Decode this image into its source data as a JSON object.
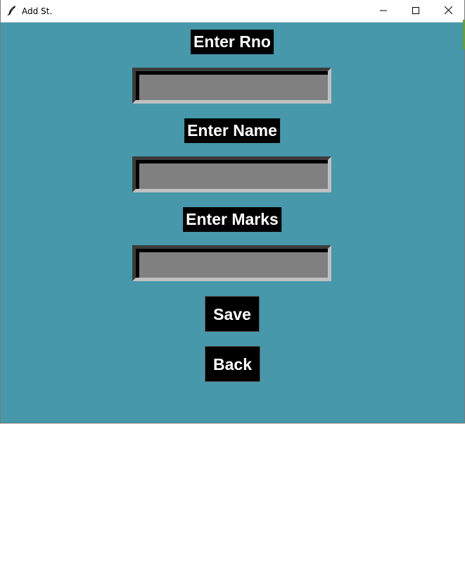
{
  "window": {
    "title": "Add St.",
    "background": "#4698aa"
  },
  "titlebar_buttons": {
    "minimize_icon": "minimize-icon",
    "maximize_icon": "maximize-icon",
    "close_icon": "close-icon"
  },
  "form": {
    "rno_label": "Enter Rno",
    "rno_value": "",
    "name_label": "Enter Name",
    "name_value": "",
    "marks_label": "Enter Marks",
    "marks_value": ""
  },
  "actions": {
    "save_label": "Save",
    "back_label": "Back"
  }
}
